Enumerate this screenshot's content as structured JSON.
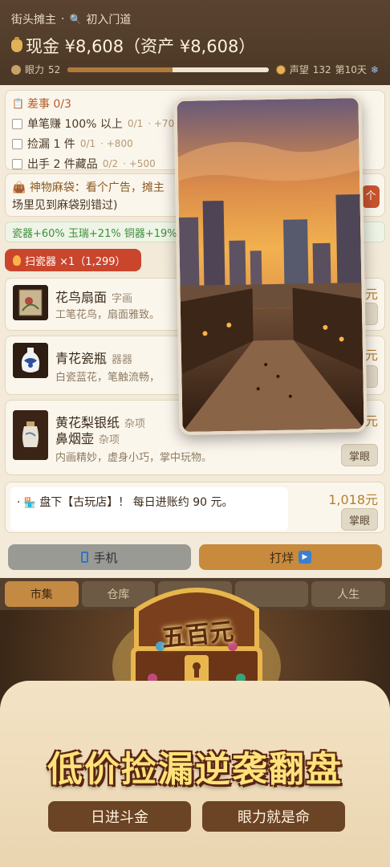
{
  "header": {
    "title": "街头摊主",
    "dot": "·",
    "rank": "初入门道",
    "cash_label": "现金 ¥8,608（资产 ¥8,608）",
    "stamina_label": "眼力",
    "stamina_value": "52",
    "stamina_fill": 0.52,
    "reputation_label": "声望",
    "reputation_value": "132",
    "day": "第10天",
    "weather_icon": "❄"
  },
  "tasks": {
    "title": "差事 0/3",
    "items": [
      {
        "label": "单笔赚 100% 以上",
        "progress": "0/1",
        "reward": "· +700"
      },
      {
        "label": "捡漏 1 件",
        "progress": "0/1",
        "reward": "· +800"
      },
      {
        "label": "出手 2 件藏品",
        "progress": "0/2",
        "reward": "· +500"
      }
    ]
  },
  "bag": {
    "line1": "神物麻袋：看个广告，摊主",
    "line2": "场里见到麻袋别错过)",
    "button": "个"
  },
  "bonus": "瓷器+60% 玉瑞+21% 铜器+19% 字",
  "scan_button": "扫瓷器 ×1（1,299）",
  "items": [
    {
      "name": "花鸟扇面",
      "category": "字画",
      "desc": "工笔花鸟，扇面雅致。",
      "price": "元",
      "button": "眼"
    },
    {
      "name": "青花瓷瓶",
      "category": "器器",
      "desc": "白瓷蓝花，笔触流畅，",
      "price": "元",
      "button": "眼"
    },
    {
      "name_line1": "黄花梨银纸",
      "category1": "杂项",
      "name_line2": "鼻烟壶",
      "category2": "杂项",
      "desc": "内画精妙，虚身小巧，掌中玩物。",
      "price": "元",
      "button": "掌眼"
    }
  ],
  "shop": {
    "text": "盘下【古玩店】！ 每日进账约 90 元。",
    "price": "1,018元",
    "button": "掌眼"
  },
  "bottom": {
    "phone": "手机",
    "walk": "打烊"
  },
  "tabs": [
    "市集",
    "仓库",
    "",
    "",
    "人生"
  ],
  "promo": {
    "chest_label": "五百元",
    "headline": "低价捡漏逆袭翻盘",
    "pill_left": "日进斗金",
    "pill_right": "眼力就是命"
  }
}
